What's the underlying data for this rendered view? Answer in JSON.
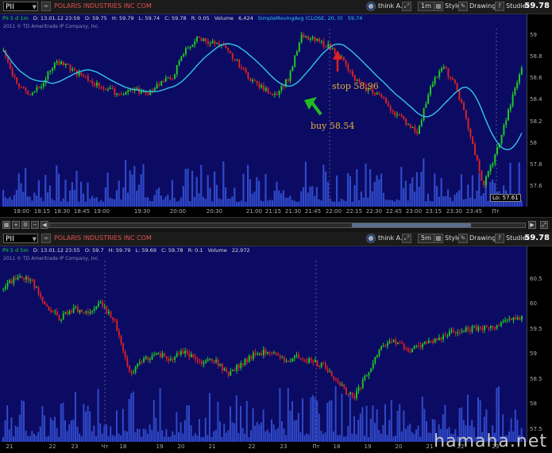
{
  "top_panel": {
    "symbol": "PII",
    "company": "POLARIS INDUSTRIES INC COM",
    "right": {
      "think": "think A.I.",
      "interval": "1m",
      "style": "Style",
      "drawings": "Drawings",
      "studies": "Studies",
      "last_price": "59.78"
    },
    "info": {
      "period": "PII 5 d 1m",
      "date": "D: 13.01.12 23:59",
      "open": "O: 59.75",
      "high": "H: 59.79",
      "low": "L: 59.74",
      "close": "C: 59.78",
      "range": "R: 0.05",
      "volume_label": "Volume",
      "volume": "6,424",
      "sma_label": "SimpleMovingAvg (CLOSE, 20, 0)",
      "sma_value": "59.74"
    },
    "copyright": "2011 © TD Ameritrade IP Company, Inc.",
    "annotations": {
      "stop": "stop 58.96",
      "buy": "buy 58.54"
    },
    "low_label": "Lo: 57.61",
    "y_ticks": [
      "59",
      "58.8",
      "58.6",
      "58.4",
      "58.2",
      "58",
      "57.8",
      "57.6"
    ],
    "x_ticks": [
      "18:00",
      "18:15",
      "18:30",
      "18:45",
      "19:00",
      "19:30",
      "20:00",
      "20:30",
      "21:00",
      "21:15",
      "21:30",
      "21:45",
      "22:00",
      "22:15",
      "22:30",
      "22:45",
      "23:00",
      "23:15",
      "23:30",
      "23:45",
      "Пт"
    ]
  },
  "bottom_panel": {
    "symbol": "PII",
    "company": "POLARIS INDUSTRIES INC COM",
    "right": {
      "think": "think A.I.",
      "interval": "5m",
      "style": "Style",
      "drawings": "Drawings",
      "studies": "Studies",
      "last_price": "59.78"
    },
    "info": {
      "period": "PII 5 d 5m",
      "date": "D: 13.01.12 23:55",
      "open": "O: 59.7",
      "high": "H: 59.79",
      "low": "L: 59.69",
      "close": "C: 59.78",
      "range": "R: 0.1",
      "volume_label": "Volume",
      "volume": "22,972"
    },
    "copyright": "2011 © TD Ameritrade IP Company, Inc.",
    "y_ticks": [
      "60.5",
      "60",
      "59.5",
      "59",
      "58.5",
      "58",
      "57.5"
    ],
    "x_ticks": [
      "21",
      "22",
      "23",
      "Чт",
      "18",
      "19",
      "20",
      "21",
      "22",
      "23",
      "Пт",
      "18",
      "19",
      "20",
      "21",
      "22",
      "23"
    ]
  },
  "watermark": "hamaha.net",
  "colors": {
    "background": "#0b0b63",
    "up": "#22cc22",
    "down": "#dd2222",
    "sma": "#33c6e6",
    "volume": "#2f49c8",
    "annotation": "#e6b03a"
  },
  "icons": [
    "gear-icon",
    "link-icon",
    "maximize-icon",
    "close-icon",
    "chevron-down-icon",
    "zoom-in-icon",
    "zoom-out-icon",
    "arrow-up-icon",
    "arrow-down-icon"
  ],
  "chart_data": [
    {
      "type": "candlestick",
      "title": "POLARIS INDUSTRIES INC COM",
      "interval": "1m",
      "ylim": [
        57.5,
        59.1
      ],
      "indicator": "SimpleMovingAvg (CLOSE, 20, 0)",
      "close_path": [
        58.85,
        58.55,
        58.45,
        58.55,
        58.75,
        58.7,
        58.62,
        58.55,
        58.5,
        58.45,
        58.5,
        58.45,
        58.55,
        58.6,
        58.85,
        58.97,
        58.93,
        58.88,
        58.75,
        58.6,
        58.5,
        58.45,
        58.6,
        58.98,
        58.95,
        58.9,
        58.8,
        58.6,
        58.5,
        58.45,
        58.3,
        58.2,
        58.1,
        58.55,
        58.7,
        58.5,
        58.1,
        57.6,
        57.9,
        58.3,
        58.7
      ],
      "annotations": [
        {
          "label": "buy 58.54",
          "y": 58.54
        },
        {
          "label": "stop 58.96",
          "y": 58.96
        }
      ],
      "low": 57.61
    },
    {
      "type": "candlestick",
      "title": "POLARIS INDUSTRIES INC COM",
      "interval": "5m",
      "ylim": [
        57.4,
        60.7
      ],
      "close_path": [
        60.3,
        60.55,
        60.45,
        60.0,
        59.7,
        59.9,
        59.8,
        60.0,
        59.6,
        58.6,
        58.9,
        59.0,
        58.9,
        59.05,
        58.8,
        58.9,
        58.6,
        58.8,
        59.0,
        59.05,
        58.85,
        58.95,
        58.85,
        58.75,
        58.4,
        58.1,
        58.6,
        59.2,
        59.25,
        59.05,
        59.2,
        59.3,
        59.45,
        59.5,
        59.5,
        59.55,
        59.65,
        59.75
      ],
      "last": 59.78
    }
  ]
}
